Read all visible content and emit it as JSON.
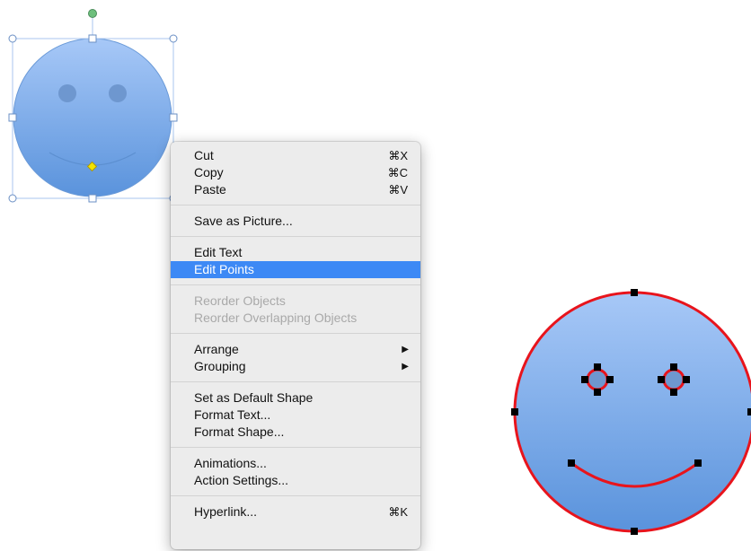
{
  "context_menu": {
    "groups": [
      [
        {
          "label": "Cut",
          "shortcut": "⌘X",
          "enabled": true
        },
        {
          "label": "Copy",
          "shortcut": "⌘C",
          "enabled": true
        },
        {
          "label": "Paste",
          "shortcut": "⌘V",
          "enabled": true
        }
      ],
      [
        {
          "label": "Save as Picture...",
          "enabled": true
        }
      ],
      [
        {
          "label": "Edit Text",
          "enabled": true
        },
        {
          "label": "Edit Points",
          "enabled": true,
          "selected": true
        }
      ],
      [
        {
          "label": "Reorder Objects",
          "enabled": false
        },
        {
          "label": "Reorder Overlapping Objects",
          "enabled": false
        }
      ],
      [
        {
          "label": "Arrange",
          "submenu": true,
          "enabled": true
        },
        {
          "label": "Grouping",
          "submenu": true,
          "enabled": true
        }
      ],
      [
        {
          "label": "Set as Default Shape",
          "enabled": true
        },
        {
          "label": "Format Text...",
          "enabled": true
        },
        {
          "label": "Format Shape...",
          "enabled": true
        }
      ],
      [
        {
          "label": "Animations...",
          "enabled": true
        },
        {
          "label": "Action Settings...",
          "enabled": true
        }
      ],
      [
        {
          "label": "Hyperlink...",
          "shortcut": "⌘K",
          "enabled": true
        }
      ]
    ]
  },
  "colors": {
    "selection_highlight": "#3d89f5",
    "shape_gradient_top": "#a7c8f7",
    "shape_gradient_bottom": "#5a93dc",
    "edit_points_outline": "#e8141c",
    "rotation_handle": "#6dbf7c",
    "adjust_handle": "#f4e400"
  }
}
